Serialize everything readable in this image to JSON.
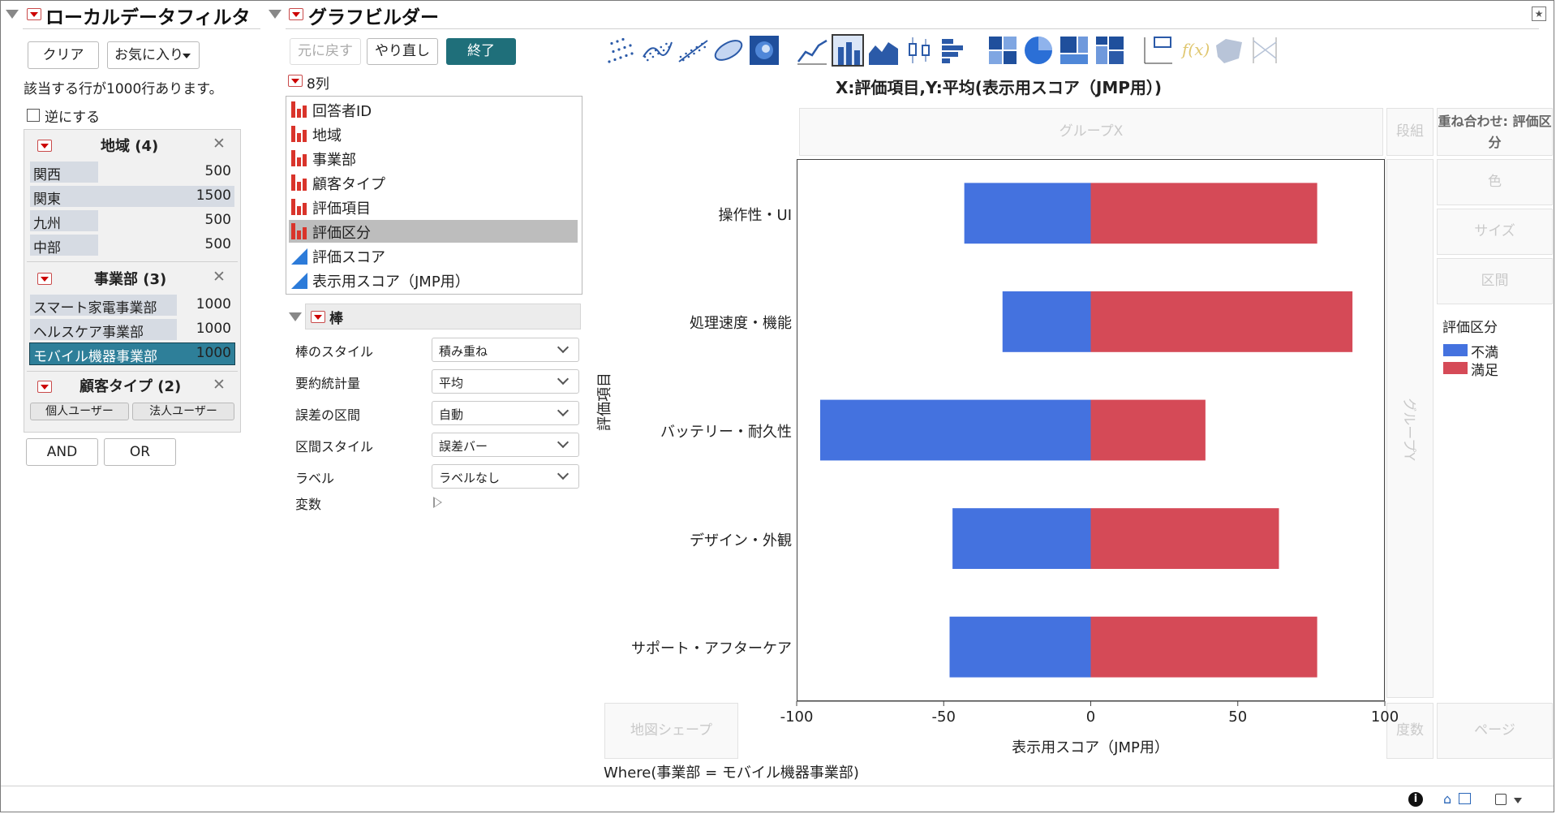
{
  "filter_panel": {
    "title": "ローカルデータフィルタ",
    "clear_label": "クリア",
    "favorites_label": "お気に入り",
    "match_text": "該当する行が1000行あります。",
    "invert_label": "逆にする",
    "groups": [
      {
        "title": "地域 (4)",
        "items": [
          {
            "label": "関西",
            "count": "500",
            "fill": 0.333,
            "selected": false
          },
          {
            "label": "関東",
            "count": "1500",
            "fill": 1.0,
            "selected": false
          },
          {
            "label": "九州",
            "count": "500",
            "fill": 0.333,
            "selected": false
          },
          {
            "label": "中部",
            "count": "500",
            "fill": 0.333,
            "selected": false
          }
        ]
      },
      {
        "title": "事業部 (3)",
        "items": [
          {
            "label": "スマート家電事業部",
            "count": "1000",
            "fill": 0.72,
            "selected": false
          },
          {
            "label": "ヘルスケア事業部",
            "count": "1000",
            "fill": 0.72,
            "selected": false
          },
          {
            "label": "モバイル機器事業部",
            "count": "1000",
            "fill": 0.72,
            "selected": true
          }
        ]
      },
      {
        "title": "顧客タイプ (2)",
        "buttons": [
          "個人ユーザー",
          "法人ユーザー"
        ]
      }
    ],
    "and_label": "AND",
    "or_label": "OR"
  },
  "graph_builder": {
    "title": "グラフビルダー",
    "undo_label": "元に戻す",
    "redo_label": "やり直し",
    "done_label": "終了",
    "columns_header": "8列",
    "columns": [
      {
        "label": "回答者ID",
        "type": "nominal",
        "selected": false
      },
      {
        "label": "地域",
        "type": "nominal",
        "selected": false
      },
      {
        "label": "事業部",
        "type": "nominal",
        "selected": false
      },
      {
        "label": "顧客タイプ",
        "type": "nominal",
        "selected": false
      },
      {
        "label": "評価項目",
        "type": "nominal",
        "selected": false
      },
      {
        "label": "評価区分",
        "type": "nominal",
        "selected": true
      },
      {
        "label": "評価スコア",
        "type": "continuous",
        "selected": false
      },
      {
        "label": "表示用スコア（JMP用）",
        "type": "continuous",
        "selected": false
      }
    ],
    "element_title": "棒",
    "properties": [
      {
        "label": "棒のスタイル",
        "value": "積み重ね"
      },
      {
        "label": "要約統計量",
        "value": "平均"
      },
      {
        "label": "誤差の区間",
        "value": "自動"
      },
      {
        "label": "区間スタイル",
        "value": "誤差バー"
      },
      {
        "label": "ラベル",
        "value": "ラベルなし"
      }
    ],
    "variables_label": "変数",
    "chart_title": "X:評価項目,Y:平均(表示用スコア（JMP用）)",
    "zones": {
      "group_x": "グループX",
      "wrap": "段組",
      "overlay": "重ね合わせ: 評価区分",
      "color": "色",
      "size": "サイズ",
      "interval": "区間",
      "group_y": "グループY",
      "map_shape": "地図シェープ",
      "freq": "度数",
      "page": "ページ"
    },
    "where_text": "Where(事業部 = モバイル機器事業部)"
  },
  "colors": {
    "negative": "#4472df",
    "positive": "#d54a57",
    "done_button": "#1f6f7a",
    "selected_row": "#2e7f99"
  },
  "chart_data": {
    "type": "bar",
    "orientation": "horizontal",
    "stacked": true,
    "categories": [
      "操作性・UI",
      "処理速度・機能",
      "バッテリー・耐久性",
      "デザイン・外観",
      "サポート・アフターケア"
    ],
    "series": [
      {
        "name": "不満",
        "values": [
          -43,
          -30,
          -92,
          -47,
          -48
        ]
      },
      {
        "name": "満足",
        "values": [
          77,
          89,
          39,
          64,
          77
        ]
      }
    ],
    "xlabel": "表示用スコア（JMP用）",
    "ylabel": "評価項目",
    "xlim": [
      -100,
      100
    ],
    "xticks": [
      -100,
      -50,
      0,
      50,
      100
    ],
    "legend_title": "評価区分",
    "legend_position": "right",
    "grid": false
  }
}
